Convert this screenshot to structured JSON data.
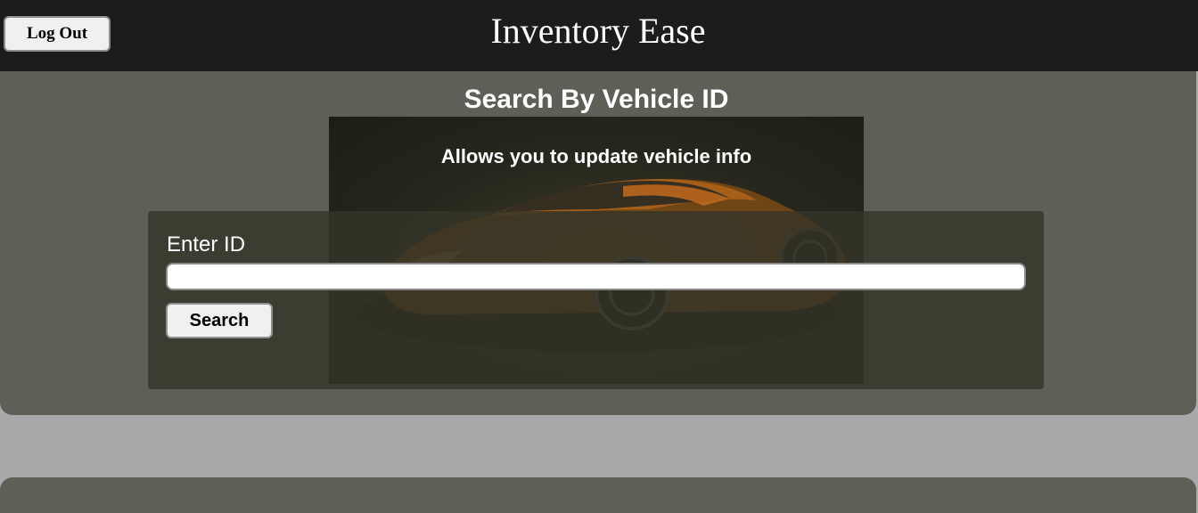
{
  "header": {
    "title": "Inventory Ease",
    "logout_label": "Log Out"
  },
  "search_panel": {
    "title": "Search By Vehicle ID",
    "hero_caption": "Allows you to update vehicle info",
    "field_label": "Enter ID",
    "input_value": "",
    "input_placeholder": "",
    "search_label": "Search"
  },
  "colors": {
    "header_bg": "#1c1c1c",
    "panel_bg": "#605f57",
    "page_bg": "#a9a9a9",
    "car_accent": "#c26a1c"
  },
  "icons": {
    "hero_image": "orange-sports-car-image"
  }
}
